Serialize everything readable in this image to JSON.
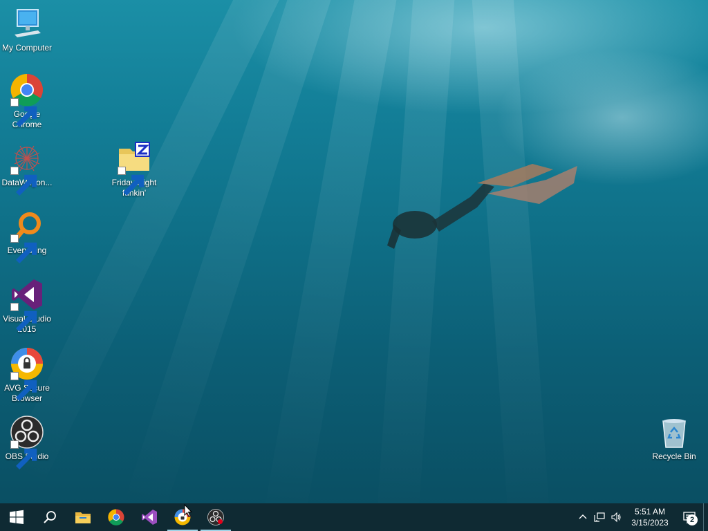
{
  "desktop": {
    "icons": [
      {
        "label": "My Computer",
        "icon": "computer-icon"
      },
      {
        "label": "Google Chrome",
        "icon": "chrome-icon"
      },
      {
        "label": "DataWagon...",
        "icon": "datawagon-icon"
      },
      {
        "label": "Everything",
        "icon": "everything-search-icon"
      },
      {
        "label": "Visual Studio 2015",
        "icon": "visual-studio-icon"
      },
      {
        "label": "AVG Secure Browser",
        "icon": "avg-browser-icon"
      },
      {
        "label": "OBS Studio",
        "icon": "obs-icon"
      },
      {
        "label": "Friday Night funkin'",
        "icon": "zip-folder-icon"
      },
      {
        "label": "Recycle Bin",
        "icon": "recycle-bin-icon"
      }
    ]
  },
  "taskbar": {
    "items": [
      "start-icon",
      "search-icon",
      "file-explorer-icon",
      "chrome-icon",
      "visual-studio-icon",
      "avg-browser-icon",
      "obs-icon"
    ],
    "clock": {
      "time": "5:51 AM",
      "date": "3/15/2023"
    },
    "notification_count": "2"
  },
  "colors": {
    "taskbar": "#0f2a33",
    "accent": "#9fd3e6"
  }
}
